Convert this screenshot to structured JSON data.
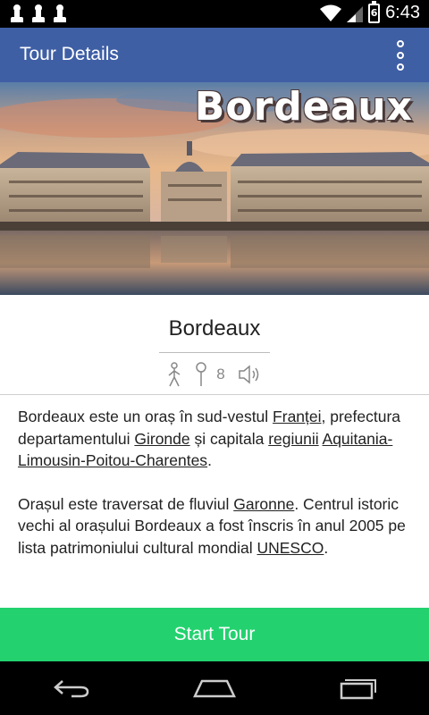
{
  "status_bar": {
    "time": "6:43",
    "battery_level": "6",
    "notification_icons": [
      "chess-pawn-icon",
      "chess-pawn-icon",
      "chess-pawn-icon"
    ]
  },
  "app_bar": {
    "title": "Tour Details",
    "overflow_icon": "overflow-menu-icon"
  },
  "hero": {
    "overlay_title": "Bordeaux"
  },
  "tour": {
    "name": "Bordeaux",
    "stops_count": "8",
    "icons": [
      "walking-person-icon",
      "map-pin-icon",
      "speaker-icon"
    ]
  },
  "description": {
    "p1": {
      "t1": "Bordeaux",
      "t2": " este un oraș în sud-vestul ",
      "l1": "Franței",
      "t3": ", prefectura departamentului ",
      "l2": "Gironde",
      "t4": " și capitala ",
      "l3": "regiunii",
      "t5": " ",
      "l4": "Aquitania-Limousin-Poitou-Charentes",
      "t6": "."
    },
    "p2": {
      "t1": "Orașul este traversat de fluviul ",
      "l1": "Garonne",
      "t2": ". Centrul istoric vechi al orașului Bordeaux a fost înscris în anul 2005 pe lista patrimoniului cultural mondial ",
      "l2": "UNESCO",
      "t3": "."
    }
  },
  "start_button": {
    "label": "Start Tour",
    "color": "#23d26f"
  },
  "colors": {
    "app_bar": "#3f5fa5",
    "status_bar": "#000000",
    "nav_bar": "#000000"
  },
  "nav_bar": {
    "icons": [
      "back-icon",
      "home-icon",
      "recents-icon"
    ]
  }
}
